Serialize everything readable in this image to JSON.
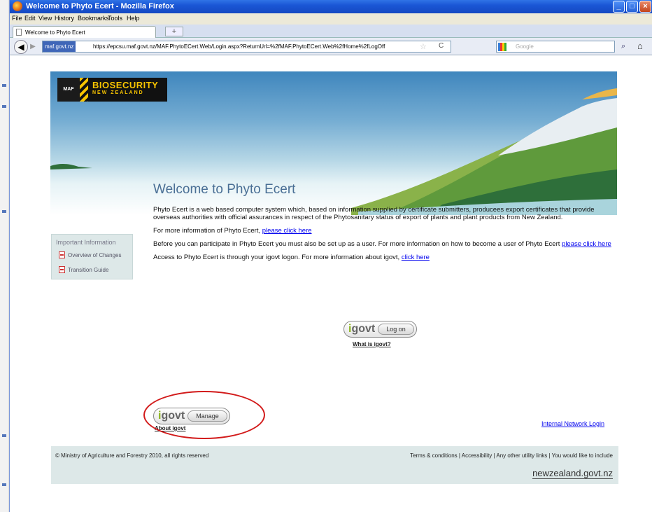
{
  "window": {
    "title": "Welcome to Phyto Ecert - Mozilla Firefox"
  },
  "menu": [
    "File",
    "Edit",
    "View",
    "History",
    "Bookmarks",
    "Tools",
    "Help"
  ],
  "tab": {
    "title": "Welcome to Phyto Ecert",
    "new_tab": "+"
  },
  "nav": {
    "site_badge": "maf.govt.nz",
    "url": "https://epcsu.maf.govt.nz/MAF.PhytoECert.Web/Login.aspx?ReturnUrl=%2fMAF.PhytoECert.Web%2fHome%2fLogOff",
    "search_placeholder": "Google"
  },
  "banner": {
    "logo_main": "BIOSECURITY",
    "logo_sub": "NEW ZEALAND",
    "logo_maf": "MAF"
  },
  "main": {
    "title": "Welcome to Phyto Ecert",
    "intro": "Phyto Ecert is a web based computer system which, based on information supplied by certificate submitters, producees export certificates that provide overseas authorities with official assurances in respect of the Phytosanitary status of export of plants and plant products from New Zealand.",
    "more_info_text": "For more information of Phyto Ecert, ",
    "more_info_link": "please click here",
    "participate_text": "Before you can participate in Phyto Ecert you must also be set up as a user. For more information on how to become a user of Phyto Ecert ",
    "participate_link": "please click here",
    "access_text": "Access to Phyto Ecert is through your igovt logon. For more information about igovt, ",
    "access_link": "click here"
  },
  "sidebar": {
    "heading": "Important Information",
    "items": [
      {
        "label": "Overview of Changes"
      },
      {
        "label": "Transition Guide"
      }
    ]
  },
  "logon": {
    "brand_i": "i",
    "brand_rest": "govt",
    "button": "Log on",
    "what_is": "What is igovt?"
  },
  "manage": {
    "brand_i": "i",
    "brand_rest": "govt",
    "button": "Manage",
    "about": "About igovt"
  },
  "internal_login": "Internal Network Login",
  "footer": {
    "copyright": "© Ministry of Agriculture and Forestry 2010, all rights reserved",
    "links": "Terms & conditions  |  Accessibility  |  Any other utility links  |  You would like to include",
    "nzgovt": "newzealand.govt.nz"
  }
}
